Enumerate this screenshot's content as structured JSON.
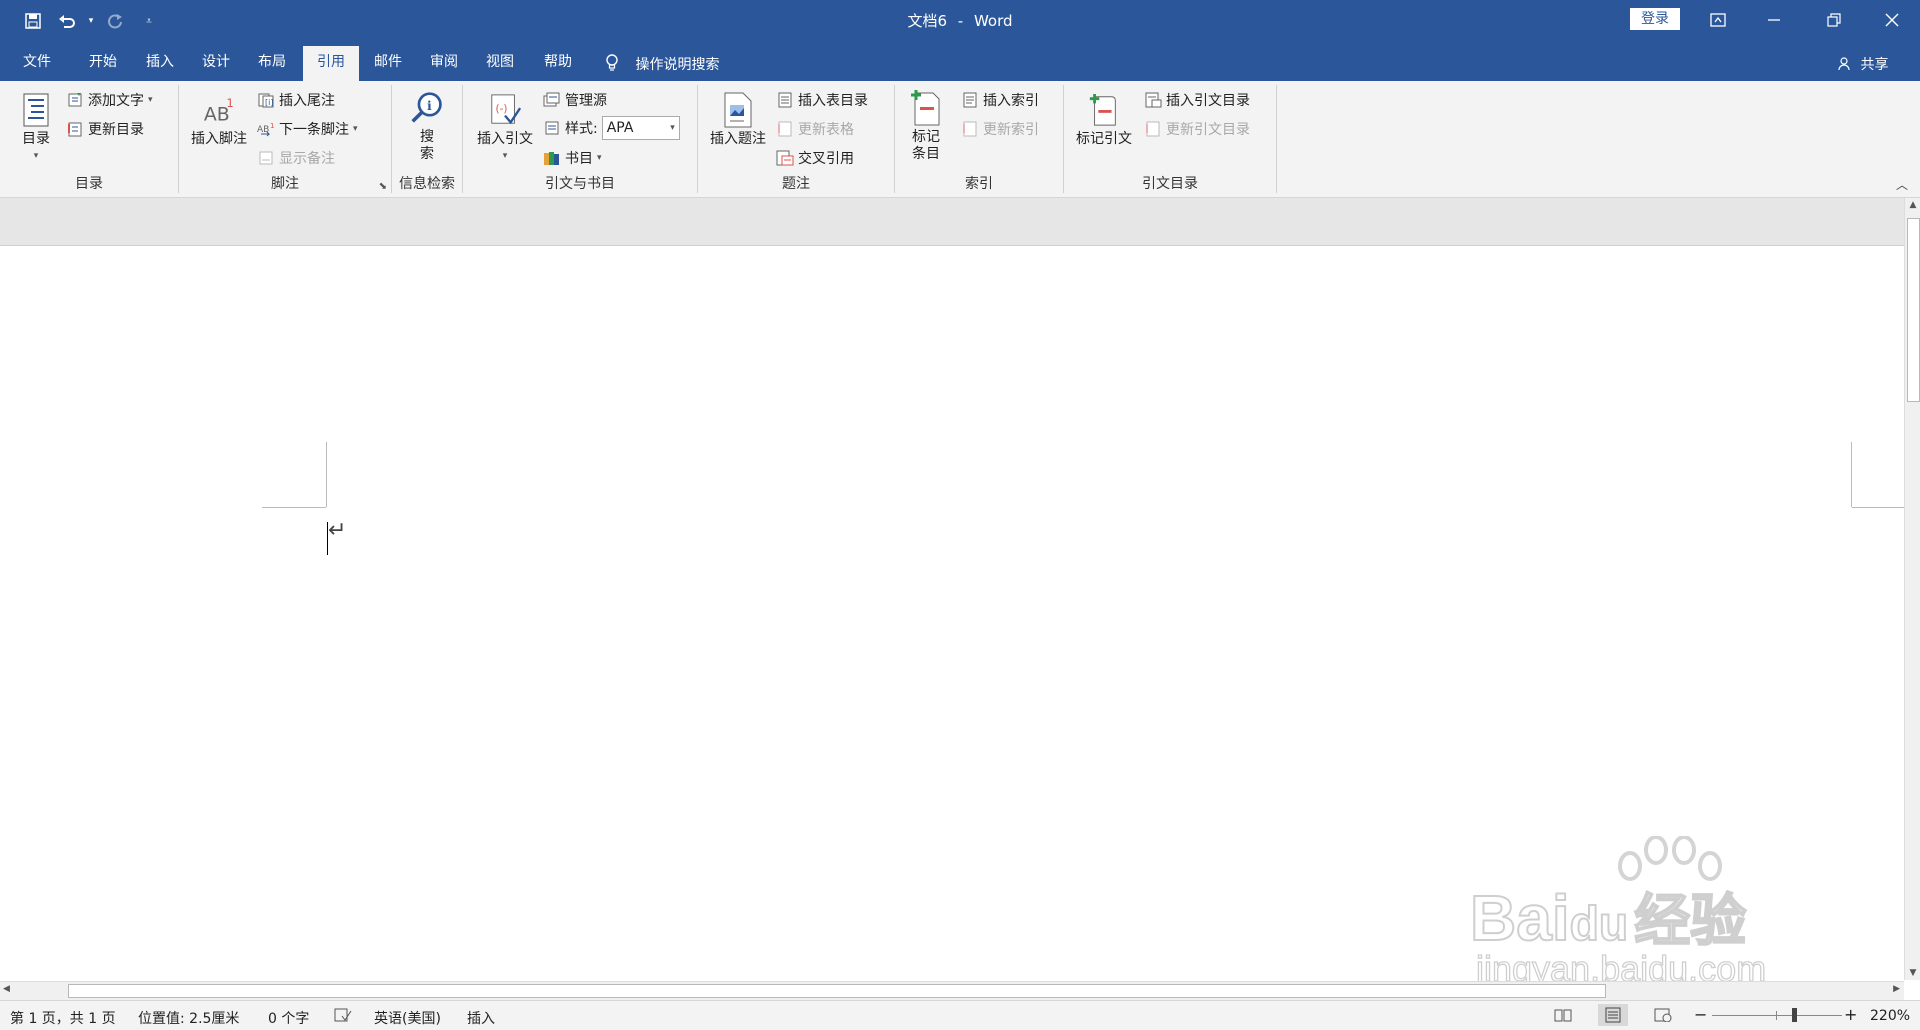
{
  "window": {
    "doc_title": "文档6",
    "separator": "-",
    "app_name": "Word",
    "login_label": "登录",
    "share_label": "共享"
  },
  "tabs": [
    "文件",
    "开始",
    "插入",
    "设计",
    "布局",
    "引用",
    "邮件",
    "审阅",
    "视图",
    "帮助"
  ],
  "active_tab": "引用",
  "tell_me": "操作说明搜索",
  "ribbon": {
    "toc": {
      "group": "目录",
      "toc_button": "目录",
      "add_text": "添加文字",
      "update_toc": "更新目录"
    },
    "footnotes": {
      "group": "脚注",
      "insert_footnote": "插入脚注",
      "insert_endnote": "插入尾注",
      "next_footnote": "下一条脚注",
      "show_notes": "显示备注"
    },
    "research": {
      "group": "信息检索",
      "search_line1": "搜",
      "search_line2": "索"
    },
    "citations": {
      "group": "引文与书目",
      "insert_citation": "插入引文",
      "manage_sources": "管理源",
      "style_label": "样式:",
      "style_value": "APA",
      "bibliography": "书目"
    },
    "captions": {
      "group": "题注",
      "insert_caption": "插入题注",
      "insert_table_of_figures": "插入表目录",
      "update_table": "更新表格",
      "cross_reference": "交叉引用"
    },
    "index": {
      "group": "索引",
      "mark_entry_line1": "标记",
      "mark_entry_line2": "条目",
      "insert_index": "插入索引",
      "update_index": "更新索引"
    },
    "authorities": {
      "group": "引文目录",
      "mark_citation": "标记引文",
      "insert_toa": "插入引文目录",
      "update_toa": "更新引文目录"
    }
  },
  "document": {
    "paragraph_mark": "↵"
  },
  "status": {
    "page": "第 1 页，共 1 页",
    "position": "位置值: 2.5厘米",
    "words": "0 个字",
    "language": "英语(美国)",
    "mode": "插入",
    "zoom": "220%"
  },
  "watermark": {
    "brand": "Bai",
    "brand2": "du",
    "cn": "经验",
    "url": "jingyan.baidu.com"
  },
  "colors": {
    "accent": "#2b579a",
    "ribbon_bg": "#f3f3f3"
  }
}
